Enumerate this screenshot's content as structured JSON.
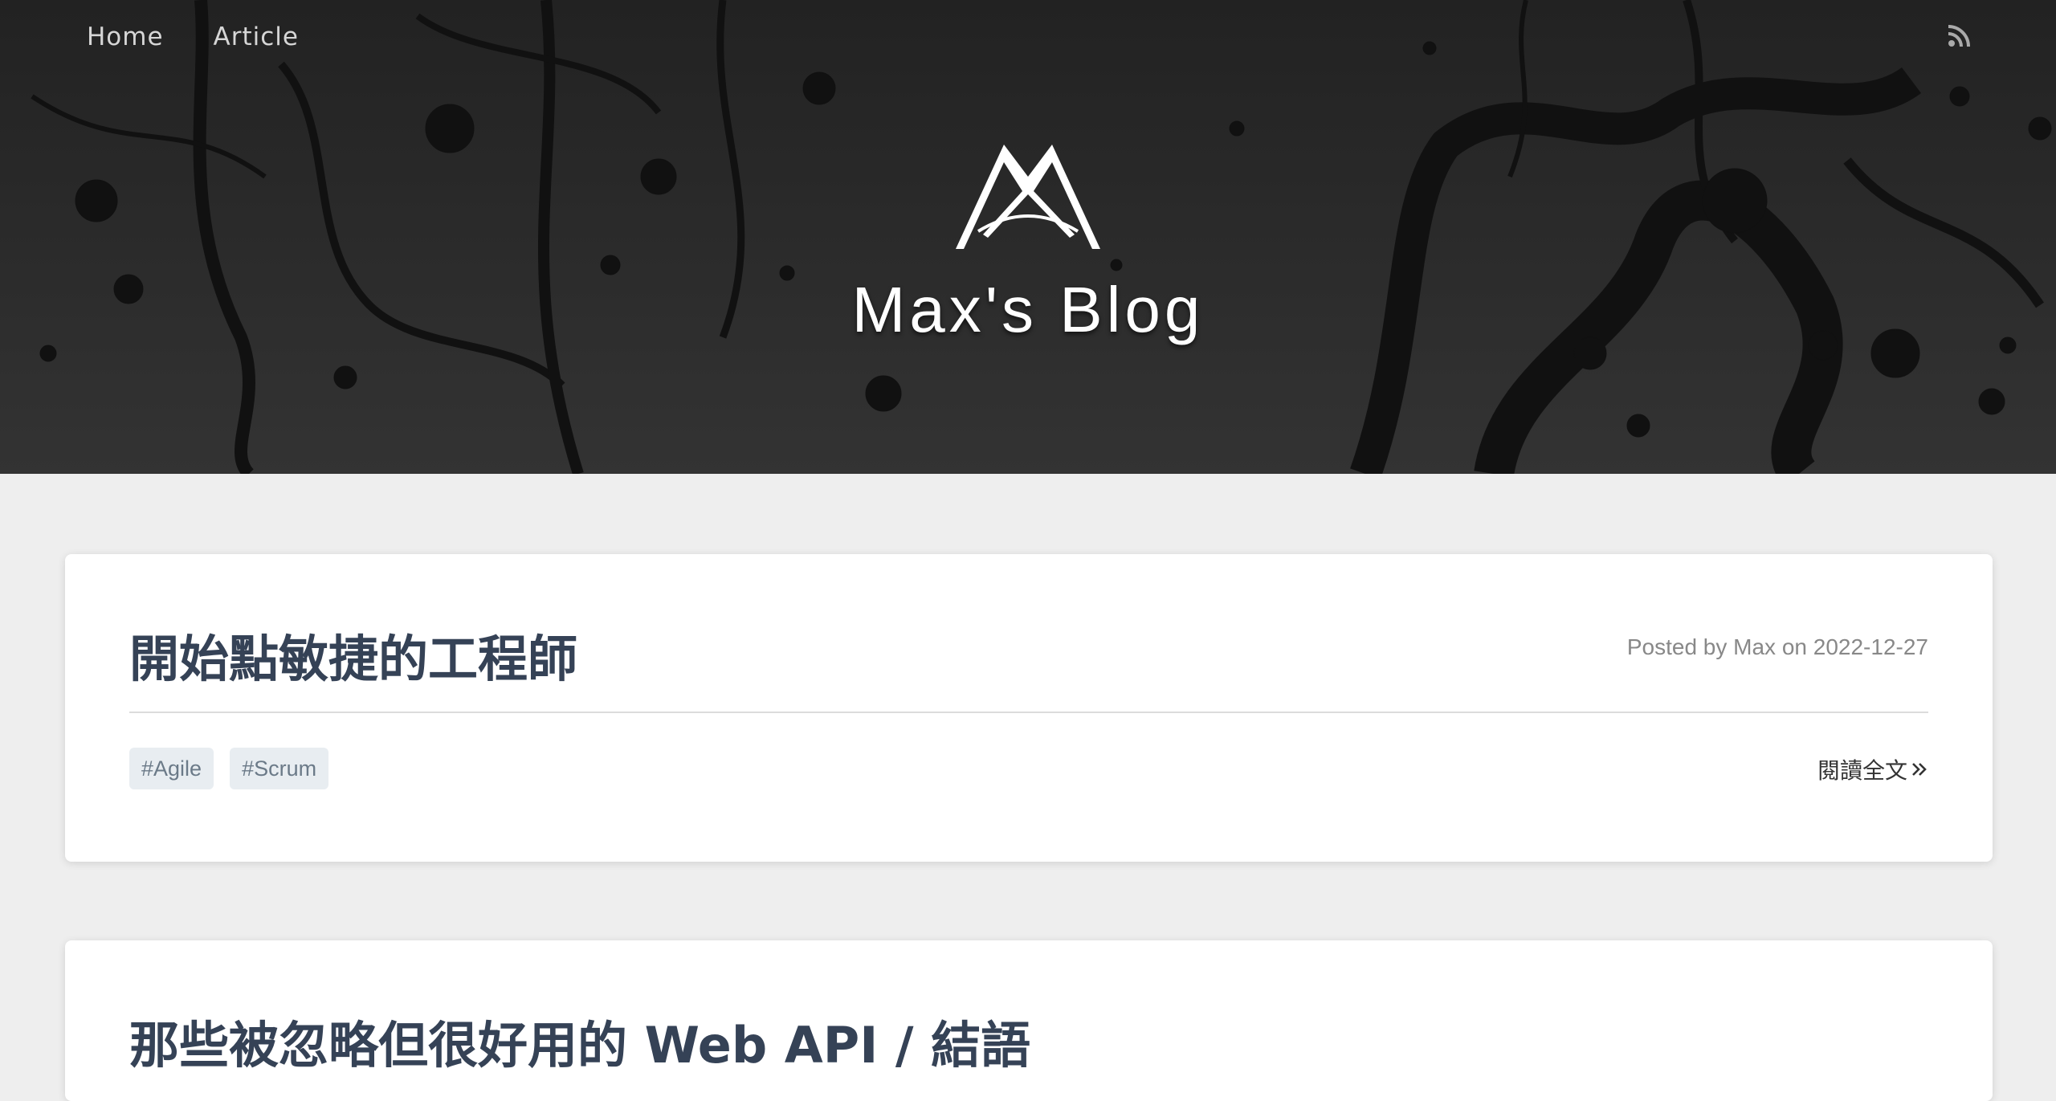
{
  "nav": {
    "items": [
      {
        "label": "Home"
      },
      {
        "label": "Article"
      }
    ]
  },
  "header": {
    "site_title": "Max's Blog",
    "logo_icon": "mountain-logo-icon",
    "rss_icon": "rss-icon"
  },
  "posts": [
    {
      "title": "開始點敏捷的工程師",
      "meta": "Posted by Max on 2022-12-27",
      "tags": [
        "#Agile",
        "#Scrum"
      ],
      "read_more": "閱讀全文"
    },
    {
      "title": "那些被忽略但很好用的 Web API / 結語"
    }
  ],
  "colors": {
    "hero_bg": "#2b2b2b",
    "page_bg": "#eeeeee",
    "title": "#354256",
    "tag_bg": "#e8edf1"
  }
}
